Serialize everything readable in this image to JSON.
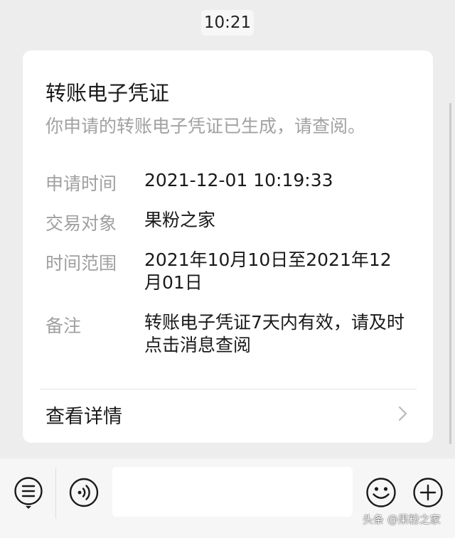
{
  "time_stamp": "10:21",
  "card": {
    "title": "转账电子凭证",
    "subtitle": "你申请的转账电子凭证已生成，请查阅。",
    "rows": [
      {
        "label": "申请时间",
        "value": "2021-12-01 10:19:33"
      },
      {
        "label": "交易对象",
        "value": "果粉之家"
      },
      {
        "label": "时间范围",
        "value": "2021年10月10日至2021年12月01日"
      },
      {
        "label": "备注",
        "value": "转账电子凭证7天内有效，请及时点击消息查阅"
      }
    ],
    "details_label": "查看详情"
  },
  "bottom_bar": {
    "icons": [
      "menu-list-icon",
      "voice-icon",
      "emoji-icon",
      "plus-icon"
    ]
  },
  "watermark": "头条 @果粉之家",
  "colors": {
    "background": "#ededed",
    "card": "#ffffff",
    "label_gray": "#a0a0a0",
    "text_dark": "#1a1a1a"
  }
}
